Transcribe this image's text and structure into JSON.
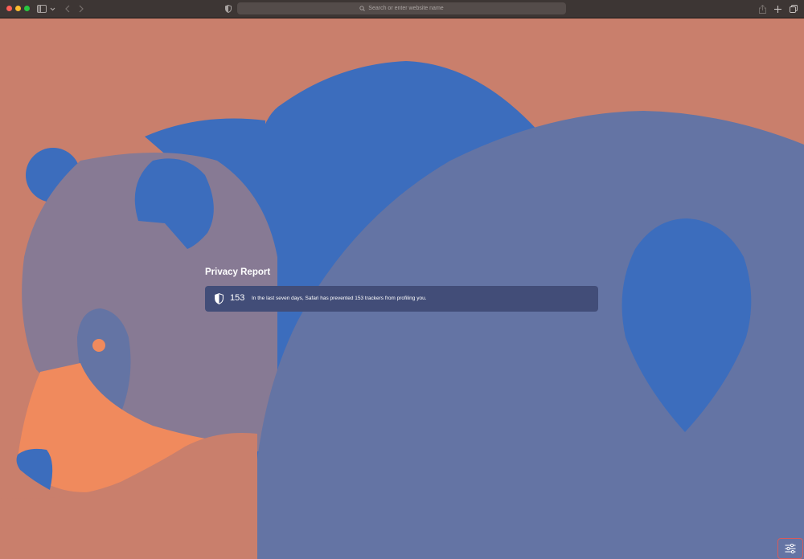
{
  "toolbar": {
    "address_placeholder": "Search or enter website name"
  },
  "privacy_report": {
    "title": "Privacy Report",
    "count": "153",
    "message": "In the last seven days, Safari has prevented 153 trackers from profiling you."
  },
  "colors": {
    "background": "#c97f6c",
    "bear_blue": "#3c6dbd",
    "bear_slate": "#6474a4",
    "bear_face": "#877a94",
    "bear_snout": "#f08a5d"
  },
  "icons": {
    "sidebar": "sidebar-icon",
    "back": "chevron-left-icon",
    "forward": "chevron-right-icon",
    "shield": "shield-icon",
    "search": "search-icon",
    "share": "share-icon",
    "new_tab": "plus-icon",
    "tabs": "tab-overview-icon",
    "customize": "sliders-icon"
  }
}
